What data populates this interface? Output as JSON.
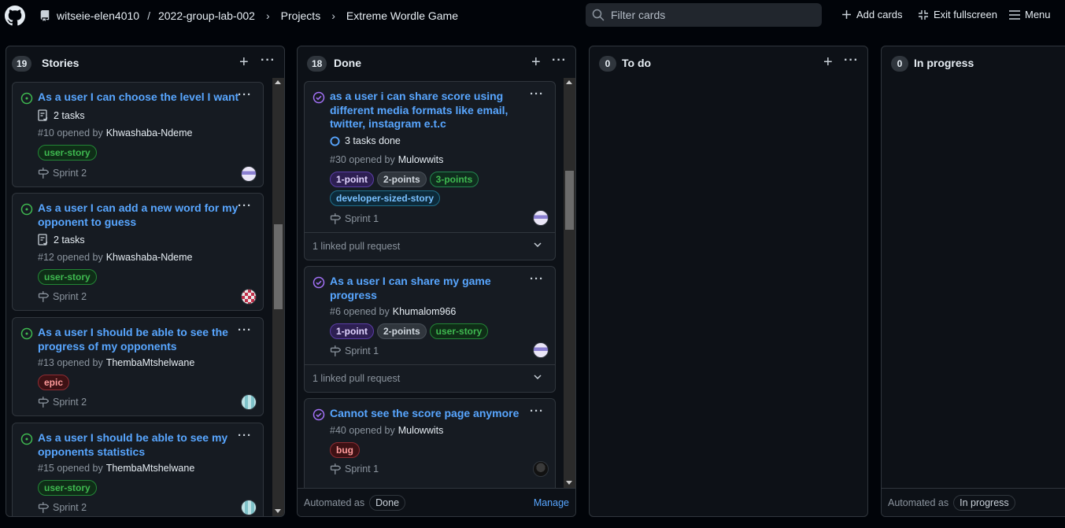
{
  "breadcrumb": {
    "org": "witseie-elen4010",
    "repo": "2022-group-lab-002",
    "projects": "Projects",
    "project": "Extreme Wordle Game"
  },
  "toolbar": {
    "filter_placeholder": "Filter cards",
    "add_cards": "Add cards",
    "exit_fullscreen": "Exit fullscreen",
    "menu": "Menu"
  },
  "colors": {
    "link": "#58a6ff",
    "open_state": "#3fb950",
    "closed_state": "#a371f7"
  },
  "columns": [
    {
      "count": "19",
      "title": "Stories",
      "cards": [
        {
          "title_lines": [
            "As a user I can choose the level I want"
          ],
          "tasks": "2 tasks",
          "meta": "#10 opened by",
          "author": "Khwashaba-Ndeme",
          "labels": [
            "user-story"
          ],
          "sprint": "Sprint 2"
        },
        {
          "title_lines": [
            "As a user I can add a new word for my",
            "opponent to guess"
          ],
          "tasks": "2 tasks",
          "meta": "#12 opened by",
          "author": "Khwashaba-Ndeme",
          "labels": [
            "user-story"
          ],
          "sprint": "Sprint 2"
        },
        {
          "title_lines": [
            "As a user I should be able to see the",
            "progress of my opponents"
          ],
          "meta": "#13 opened by",
          "author": "ThembaMtshelwane",
          "labels": [
            "epic"
          ],
          "sprint": "Sprint 2"
        },
        {
          "title_lines": [
            "As a user I should be able to see my",
            "opponents statistics"
          ],
          "meta": "#15 opened by",
          "author": "ThembaMtshelwane",
          "labels": [
            "user-story"
          ],
          "sprint": "Sprint 2"
        }
      ]
    },
    {
      "count": "18",
      "title": "Done",
      "cards": [
        {
          "title_lines": [
            "as a user i can share score using",
            "different media formats like email,",
            "twitter, instagram e.t.c"
          ],
          "tasks": "3 tasks done",
          "meta": "#30 opened by",
          "author": "Mulowwits",
          "labels": [
            "1-point",
            "2-points",
            "3-points",
            "developer-sized-story"
          ],
          "sprint": "Sprint 1",
          "linked": "1 linked pull request"
        },
        {
          "title_lines": [
            "As a user I can share my game",
            "progress"
          ],
          "meta": "#6 opened by",
          "author": "Khumalom966",
          "labels": [
            "1-point",
            "2-points",
            "user-story"
          ],
          "sprint": "Sprint 1",
          "linked": "1 linked pull request"
        },
        {
          "title_lines": [
            "Cannot see the score page anymore"
          ],
          "meta": "#40 opened by",
          "author": "Mulowwits",
          "labels": [
            "bug"
          ],
          "sprint": "Sprint 1"
        }
      ],
      "automated_label": "Automated as",
      "automated_value": "Done",
      "manage": "Manage"
    },
    {
      "count": "0",
      "title": "To do",
      "cards": []
    },
    {
      "count": "0",
      "title": "In progress",
      "cards": [],
      "automated_label": "Automated as",
      "automated_value": "In progress"
    }
  ]
}
